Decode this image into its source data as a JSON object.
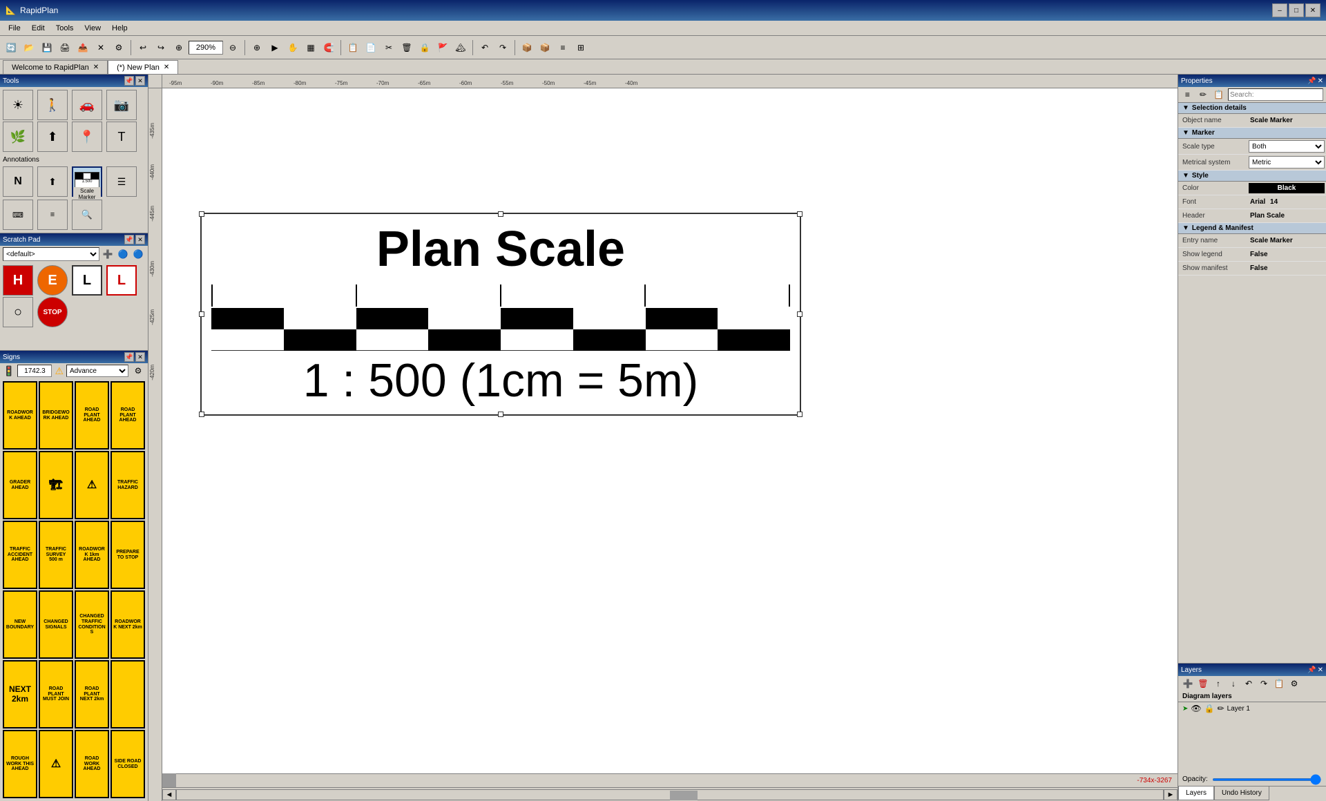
{
  "titlebar": {
    "icon": "📐",
    "title": "RapidPlan",
    "win_min": "–",
    "win_max": "□",
    "win_close": "✕"
  },
  "menubar": {
    "items": [
      "File",
      "Edit",
      "Tools",
      "View",
      "Help"
    ]
  },
  "toolbar": {
    "zoom_value": "290%",
    "buttons": [
      "↩",
      "↪",
      "⊕",
      "⊖",
      "▶",
      "▼",
      "▦",
      "▥",
      "⊞",
      "⊟",
      "📋",
      "📋",
      "✂",
      "🗑",
      "🔒",
      "✔",
      "⚡",
      "✕",
      "🏔",
      "↶",
      "↷",
      "↶",
      "↷",
      "📋",
      "🗑",
      "✂",
      "📐"
    ]
  },
  "tabs": {
    "items": [
      {
        "label": "Welcome to RapidPlan",
        "closable": true,
        "active": false
      },
      {
        "label": "(*) New Plan",
        "closable": true,
        "active": true
      }
    ]
  },
  "tools_panel": {
    "title": "Tools",
    "tools": [
      {
        "icon": "☀",
        "label": "Select"
      },
      {
        "icon": "🚶",
        "label": "Pedestrian"
      },
      {
        "icon": "🚗",
        "label": "Vehicle"
      },
      {
        "icon": "📷",
        "label": "Camera"
      },
      {
        "icon": "🌿",
        "label": "Grass"
      },
      {
        "icon": "⚡",
        "label": "Arrow"
      },
      {
        "icon": "📍",
        "label": "Marker"
      },
      {
        "icon": "🖊",
        "label": "Text"
      }
    ],
    "annotations_label": "Annotations",
    "annotations": [
      {
        "icon": "N",
        "label": "North"
      },
      {
        "icon": "⬆",
        "label": "Arrow"
      },
      {
        "icon": "▦",
        "label": "Scale Marker",
        "active": true
      },
      {
        "icon": "☰",
        "label": "Table"
      }
    ],
    "scale_marker_label": "Scale Marker",
    "ann_row2": [
      {
        "icon": "⌨",
        "label": "Keyboard"
      },
      {
        "icon": "≡",
        "label": "List"
      },
      {
        "icon": "🔍",
        "label": "Magnifier"
      }
    ]
  },
  "scratch_pad": {
    "title": "Scratch Pad",
    "default_option": "<default>",
    "items": [
      {
        "icon": "H",
        "color": "red",
        "label": "H sign"
      },
      {
        "icon": "E",
        "color": "orange",
        "label": "E sign"
      },
      {
        "icon": "L",
        "color": "black-outline",
        "label": "L sign"
      },
      {
        "icon": "L",
        "color": "red-outline",
        "label": "L red sign"
      },
      {
        "icon": "○",
        "color": "white",
        "label": "Circle"
      },
      {
        "icon": "STOP",
        "color": "red",
        "label": "Stop sign"
      }
    ]
  },
  "signs_panel": {
    "title": "Signs",
    "number": "1742.3",
    "category": "Advance",
    "signs": [
      {
        "text": "ROADWORK AHEAD",
        "color": "yellow"
      },
      {
        "text": "BRIDGEWORK AHEAD",
        "color": "yellow"
      },
      {
        "text": "ROAD PLANT AHEAD",
        "color": "yellow"
      },
      {
        "text": "ROAD PLANT AHEAD",
        "color": "yellow"
      },
      {
        "text": "GRADER AHEAD",
        "color": "yellow"
      },
      {
        "text": "🏗",
        "color": "yellow"
      },
      {
        "text": "⚠",
        "color": "yellow"
      },
      {
        "text": "TRAFFIC HAZARD",
        "color": "yellow"
      },
      {
        "text": "TRAFFIC ACCIDENT AHEAD",
        "color": "yellow"
      },
      {
        "text": "TRAFFIC SURVEY 500m",
        "color": "yellow"
      },
      {
        "text": "ROADWORK 1km AHEAD",
        "color": "yellow"
      },
      {
        "text": "PREPARE TO STOP",
        "color": "yellow"
      },
      {
        "text": "NEW BOUNDARY",
        "color": "yellow"
      },
      {
        "text": "CHANGED SIGNALS",
        "color": "yellow"
      },
      {
        "text": "CHANGED TRAFFIC CONDITIONS",
        "color": "yellow"
      },
      {
        "text": "ROADWORK NEXT 2km",
        "color": "yellow"
      },
      {
        "text": "NEXT 2km",
        "color": "yellow",
        "large": true
      },
      {
        "text": "ROAD PLANT MUST JOIN",
        "color": "yellow"
      },
      {
        "text": "ROAD PLANT NEXT 2km",
        "color": "yellow"
      },
      {
        "text": "",
        "color": "yellow"
      },
      {
        "text": "ROUGH WORK THIS AHEAD",
        "color": "yellow"
      },
      {
        "text": "⚠",
        "color": "yellow"
      },
      {
        "text": "ROAD WORK AHEAD",
        "color": "yellow"
      },
      {
        "text": "SIDE ROAD CLOSED",
        "color": "yellow"
      }
    ]
  },
  "canvas": {
    "status_coords": "-734x-3267",
    "zoom": "290%",
    "ruler_marks": [
      "-95m",
      "-90m",
      "-85m",
      "-80m",
      "-75m",
      "-70m",
      "-65m",
      "-60m",
      "-55m",
      "-50m",
      "-45m",
      "-40m"
    ],
    "ruler_marks_v": [
      "-435m",
      "-440m",
      "-445m",
      "-430m",
      "-435m",
      "-440m",
      "-445m",
      "-425m",
      "-430m",
      "-435m",
      "-440m",
      "-445m"
    ]
  },
  "scale_marker": {
    "title": "Plan Scale",
    "ratio": "1 : 500 (1cm = 5m)"
  },
  "properties": {
    "title": "Properties",
    "search_placeholder": "Search:",
    "selection_details": {
      "header": "Selection details",
      "object_name_label": "Object name",
      "object_name_value": "Scale Marker"
    },
    "marker": {
      "header": "Marker",
      "scale_type_label": "Scale type",
      "scale_type_value": "Both",
      "metrical_system_label": "Metrical system",
      "metrical_system_value": "Metric"
    },
    "style": {
      "header": "Style",
      "color_label": "Color",
      "color_value": "Black",
      "font_label": "Font",
      "font_value": "Arial",
      "font_size": "14",
      "header_label": "Header",
      "header_value": "Plan Scale"
    },
    "legend_manifest": {
      "header": "Legend & Manifest",
      "entry_name_label": "Entry name",
      "entry_name_value": "Scale Marker",
      "show_legend_label": "Show legend",
      "show_legend_value": "False",
      "show_manifest_label": "Show manifest",
      "show_manifest_value": "False"
    }
  },
  "layers": {
    "title": "Layers",
    "diagram_layers_label": "Diagram layers",
    "items": [
      {
        "icon": "➤",
        "name": "Layer 1",
        "visible": true
      }
    ],
    "opacity_label": "Opacity:"
  },
  "bottom_tabs": {
    "items": [
      "Layers",
      "Undo History"
    ]
  }
}
